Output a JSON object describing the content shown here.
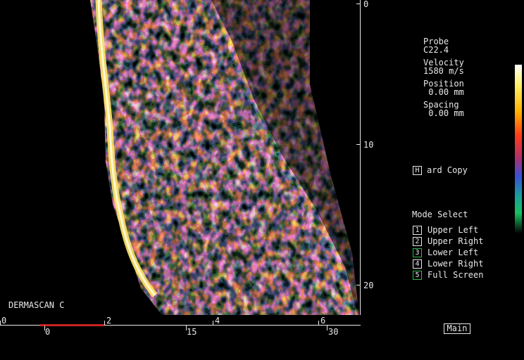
{
  "probe": {
    "label": "Probe",
    "value": "C22.4"
  },
  "velocity": {
    "label": "Velocity",
    "value": "1580 m/s"
  },
  "position": {
    "label": "Position",
    "value": " 0.00 mm"
  },
  "spacing": {
    "label": "Spacing",
    "value": " 0.00 mm"
  },
  "hard_copy": {
    "key": "H",
    "label": "ard Copy"
  },
  "mode_select": {
    "title": "Mode Select",
    "items": [
      {
        "key": "1",
        "label": "Upper Left"
      },
      {
        "key": "2",
        "label": "Upper Right"
      },
      {
        "key": "3",
        "label": "Lower Left"
      },
      {
        "key": "4",
        "label": "Lower Right"
      },
      {
        "key": "5",
        "label": "Full Screen"
      }
    ]
  },
  "depth_scale": [
    "0",
    "10",
    "20"
  ],
  "device_name": "DERMASCAN C",
  "top_scale": [
    "0",
    "2",
    "4",
    "6"
  ],
  "bottom_scale": [
    "0",
    "15",
    "30"
  ],
  "main_button": "Main",
  "colors": {
    "accent_green": "#2fb84a",
    "marker_red": "#cc2222"
  }
}
